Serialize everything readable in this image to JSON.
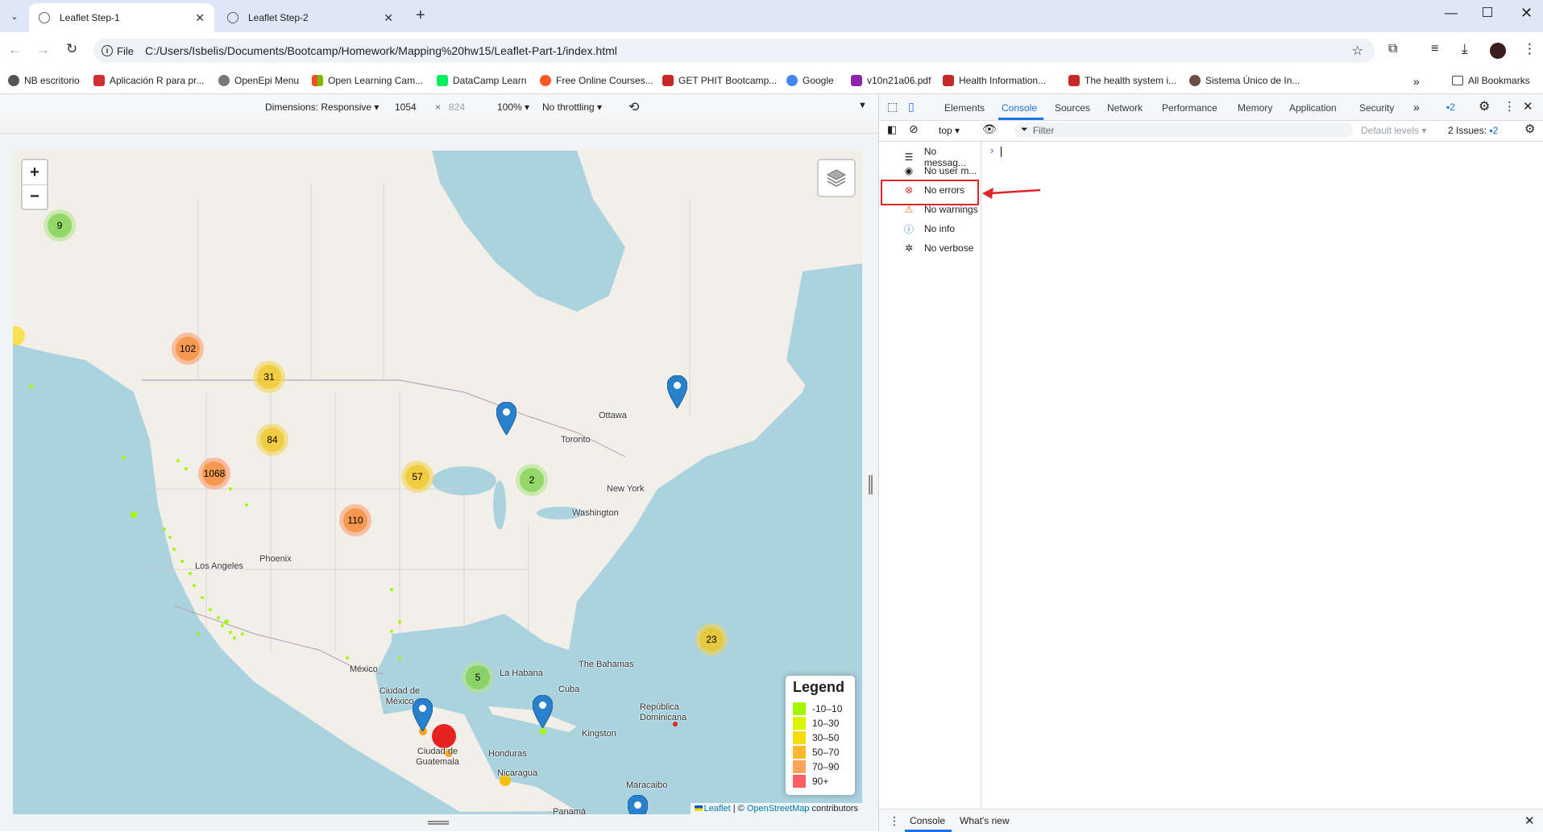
{
  "tabs": [
    {
      "title": "Leaflet Step-1",
      "active": true
    },
    {
      "title": "Leaflet Step-2",
      "active": false
    }
  ],
  "address": {
    "scheme_chip": "File",
    "url": "C:/Users/Isbelis/Documents/Bootcamp/Homework/Mapping%20hw15/Leaflet-Part-1/index.html"
  },
  "bookmarks": [
    {
      "label": "NB escritorio",
      "color": "#555555"
    },
    {
      "label": "Aplicación R para pr...",
      "color": "#d32f2f"
    },
    {
      "label": "OpenEpi Menu",
      "color": "#777777"
    },
    {
      "label": "Open Learning Cam...",
      "color": "#f4b400"
    },
    {
      "label": "DataCamp Learn",
      "color": "#03ef62"
    },
    {
      "label": "Free Online Courses...",
      "color": "#ff5722"
    },
    {
      "label": "GET PHIT Bootcamp...",
      "color": "#c62828"
    },
    {
      "label": "Google",
      "color": "#4285f4"
    },
    {
      "label": "v10n21a06.pdf",
      "color": "#8e24aa"
    },
    {
      "label": "Health Information...",
      "color": "#c62828"
    },
    {
      "label": "The health system i...",
      "color": "#c62828"
    },
    {
      "label": "Sistema Único de In...",
      "color": "#6d4c41"
    }
  ],
  "all_bookmarks": "All Bookmarks",
  "device_toolbar": {
    "dimensions": "Dimensions: Responsive",
    "width": "1054",
    "times": "×",
    "height": "824",
    "zoom": "100%",
    "throttle": "No throttling"
  },
  "map": {
    "zoom_in": "+",
    "zoom_out": "−",
    "clusters": [
      {
        "count": "9",
        "color": "green"
      },
      {
        "count": "102",
        "color": "orange"
      },
      {
        "count": "31",
        "color": "yellow"
      },
      {
        "count": "84",
        "color": "yellow"
      },
      {
        "count": "1068",
        "color": "orange"
      },
      {
        "count": "57",
        "color": "yellow"
      },
      {
        "count": "110",
        "color": "orange"
      },
      {
        "count": "2",
        "color": "green"
      },
      {
        "count": "23",
        "color": "yellow"
      },
      {
        "count": "5",
        "color": "green"
      }
    ],
    "places": [
      "Ottawa",
      "Toronto",
      "New York",
      "Washington",
      "Phoenix",
      "Los Angeles",
      "México",
      "Ciudad de México",
      "Ciudad de Guatemala",
      "La Habana",
      "Cuba",
      "The Bahamas",
      "República Dominicana",
      "Kingston",
      "Honduras",
      "Nicaragua",
      "Maracaibo",
      "Panamá"
    ],
    "legend": {
      "title": "Legend",
      "items": [
        {
          "label": "-10–10",
          "color": "#a3f600"
        },
        {
          "label": "10–30",
          "color": "#dcf400"
        },
        {
          "label": "30–50",
          "color": "#f7db11"
        },
        {
          "label": "50–70",
          "color": "#fdb72a"
        },
        {
          "label": "70–90",
          "color": "#fca35d"
        },
        {
          "label": "90+",
          "color": "#ff5f65"
        }
      ]
    },
    "attribution": {
      "leaflet": "Leaflet",
      "sep": " | © ",
      "osm": "OpenStreetMap",
      "suffix": " contributors"
    }
  },
  "devtools": {
    "tabs": [
      "Elements",
      "Console",
      "Sources",
      "Network",
      "Performance",
      "Memory",
      "Application",
      "Security"
    ],
    "active_tab": "Console",
    "issues_badge": "2",
    "context": "top",
    "filter_placeholder": "Filter",
    "levels": "Default levels",
    "issues": "2 Issues:",
    "issues_count": "2",
    "sidebar": [
      {
        "label": "No messag...",
        "icon": "list-icon"
      },
      {
        "label": "No user m...",
        "icon": "user-icon"
      },
      {
        "label": "No errors",
        "icon": "error-icon"
      },
      {
        "label": "No warnings",
        "icon": "warning-icon"
      },
      {
        "label": "No info",
        "icon": "info-icon"
      },
      {
        "label": "No verbose",
        "icon": "bug-icon"
      }
    ],
    "prompt": "›",
    "drawer_tabs": [
      "Console",
      "What's new"
    ]
  },
  "colors": {
    "highlight": "#e0242b",
    "accent": "#1a73e8"
  }
}
